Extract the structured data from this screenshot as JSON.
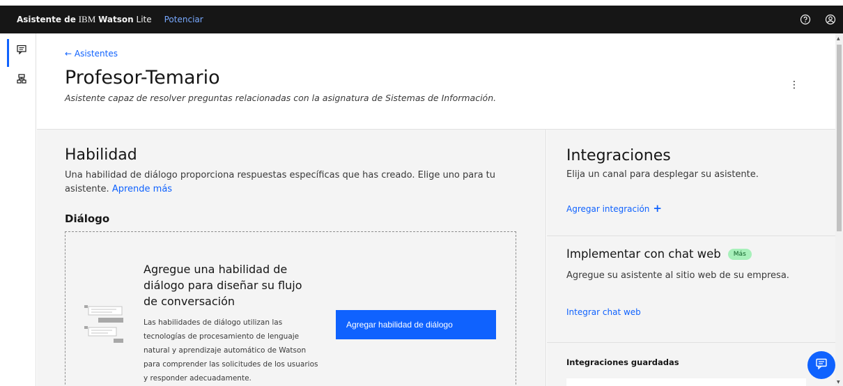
{
  "header": {
    "brand_prefix": "Asistente de",
    "brand_ibm": "IBM",
    "brand_watson": "Watson",
    "brand_suffix": "Lite",
    "upgrade_label": "Potenciar",
    "help_icon": "help-icon",
    "user_icon": "user-icon"
  },
  "rail": {
    "items": [
      {
        "icon": "chat-icon",
        "active": true
      },
      {
        "icon": "skills-icon",
        "active": false
      }
    ]
  },
  "page": {
    "back_label": "← Asistentes",
    "title": "Profesor-Temario",
    "description": "Asistente capaz de resolver preguntas relacionadas con la asignatura de Sistemas de Información.",
    "overflow_label": "⋮"
  },
  "skills": {
    "title": "Habilidad",
    "description": "Una habilidad de diálogo proporciona respuestas específicas que has creado. Elige uno para tu asistente.",
    "learn_more": "Aprende más",
    "dialog_heading": "Diálogo",
    "card_heading": "Agregue una habilidad de diálogo para diseñar su flujo de conversación",
    "card_body": "Las habilidades de diálogo utilizan las tecnologías de procesamiento de lenguaje natural y aprendizaje automático de Watson para comprender las solicitudes de los usuarios y responder adecuadamente.",
    "add_button": "Agregar habilidad de diálogo"
  },
  "integrations": {
    "title": "Integraciones",
    "description": "Elija un canal para desplegar su asistente.",
    "add_label": "Agregar integración",
    "add_plus": "+"
  },
  "webchat": {
    "title": "Implementar con chat web",
    "badge": "Más",
    "description": "Agregue su asistente al sitio web de su empresa.",
    "link": "Integrar chat web"
  },
  "saved": {
    "title": "Integraciones guardadas"
  },
  "colors": {
    "accent": "#0f62fe",
    "header_bg": "#161616",
    "section_bg": "#f4f4f4",
    "badge_bg": "#a7f0ba"
  }
}
